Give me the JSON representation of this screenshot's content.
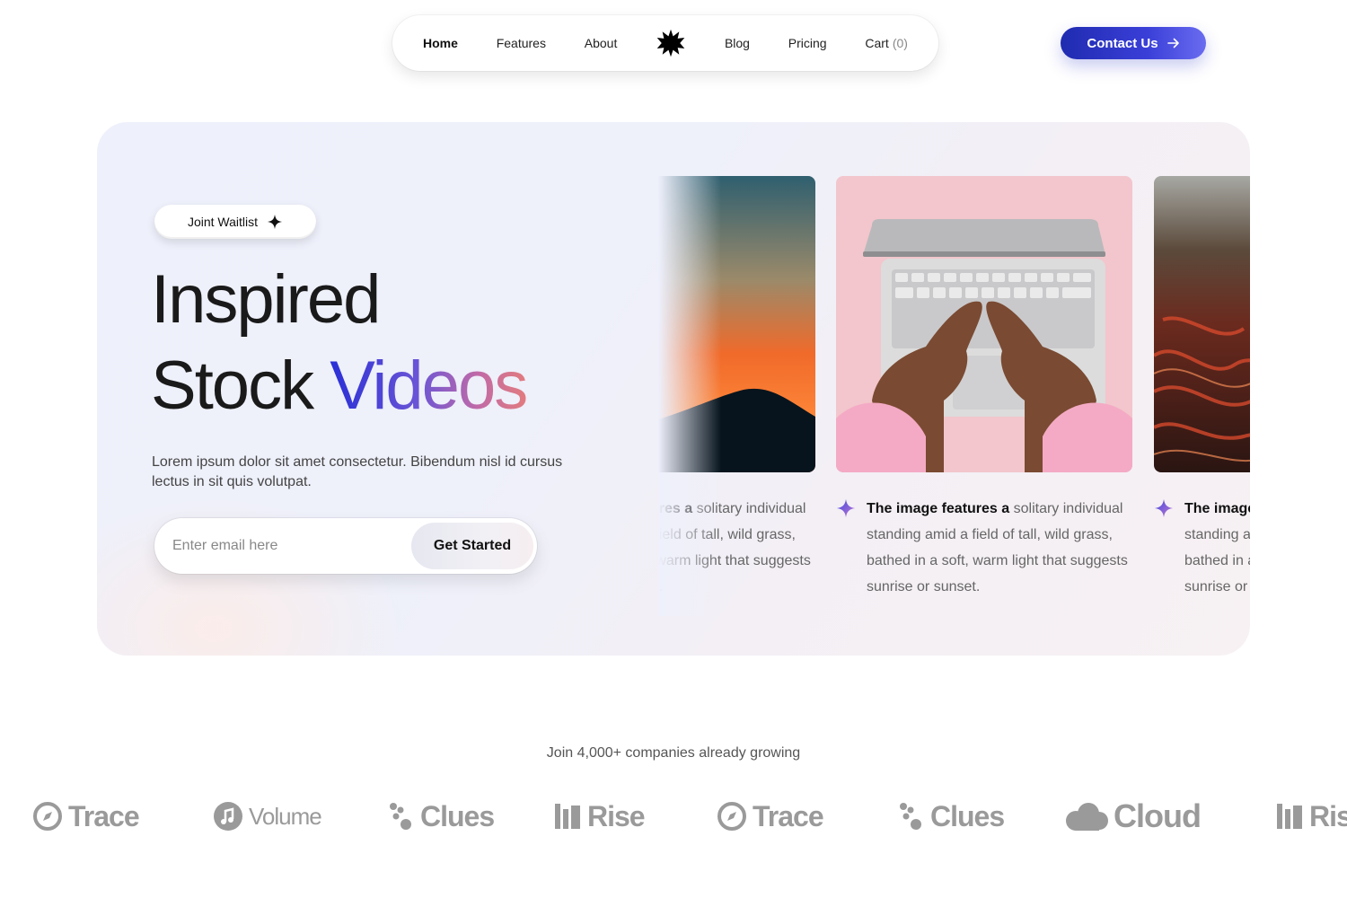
{
  "nav": {
    "items": [
      {
        "label": "Home"
      },
      {
        "label": "Features"
      },
      {
        "label": "About"
      },
      {
        "label": "Blog"
      },
      {
        "label": "Pricing"
      },
      {
        "label": "Cart"
      }
    ],
    "cart_count": "(0)",
    "logo_icon": "starburst-logo-icon"
  },
  "contact": {
    "label": "Contact Us",
    "icon": "arrow-right-icon"
  },
  "hero": {
    "waitlist_label": "Joint Waitlist",
    "headline_line1": "Inspired",
    "headline_word1": "Stock",
    "headline_word2": "Videos",
    "description": "Lorem ipsum dolor sit amet consectetur. Bibendum nisl id cursus lectus in sit quis volutpat.",
    "email_placeholder": "Enter email here",
    "cta_label": "Get Started"
  },
  "carousel": {
    "cards": [
      {
        "caption_bold": "The image features a",
        "caption_rest": "solitary individual standing amid a field of tall, wild grass, bathed in a soft, warm light that suggests sunrise or sunset.",
        "image": "sunset-mountain"
      },
      {
        "caption_bold": "The image features a",
        "caption_rest": "solitary individual standing amid a field of tall, wild grass, bathed in a soft, warm light that suggests sunrise or sunset.",
        "image": "laptop-typing"
      },
      {
        "caption_bold": "The image features a",
        "caption_rest": "solitary individual standing amid a field of tall, wild grass, bathed in a soft, warm light that suggests sunrise or sunset.",
        "image": "red-landscape"
      }
    ]
  },
  "companies": {
    "title": "Join 4,000+ companies already growing",
    "logos": [
      {
        "name": "Trace",
        "icon": "compass-icon"
      },
      {
        "name": "Volume",
        "icon": "music-note-icon"
      },
      {
        "name": "Clues",
        "icon": "paw-icon"
      },
      {
        "name": "Rise",
        "icon": "building-icon"
      },
      {
        "name": "Trace",
        "icon": "compass-icon"
      },
      {
        "name": "Clues",
        "icon": "paw-icon"
      },
      {
        "name": "Cloud",
        "icon": "cloud-icon"
      },
      {
        "name": "Rise",
        "icon": "building-icon"
      }
    ]
  },
  "colors": {
    "accent": "#2a2fd6",
    "gradient_end": "#e27b7e",
    "button_blue": "#1f2bb0"
  }
}
